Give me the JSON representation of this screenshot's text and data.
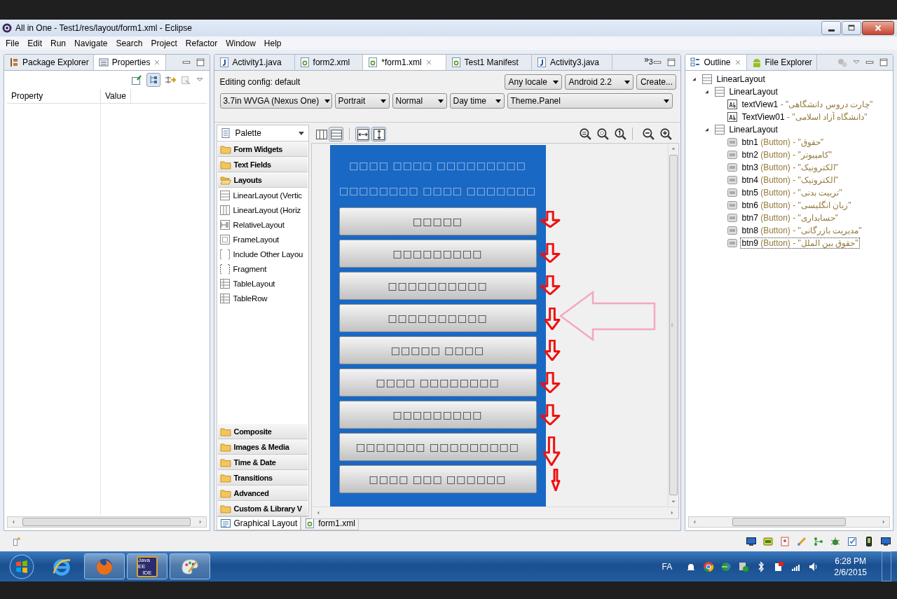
{
  "window": {
    "title": "All in One - Test1/res/layout/form1.xml - Eclipse"
  },
  "menu": [
    "File",
    "Edit",
    "Run",
    "Navigate",
    "Search",
    "Project",
    "Refactor",
    "Window",
    "Help"
  ],
  "left_panel": {
    "tabs": [
      {
        "label": "Package Explorer",
        "kind": "package",
        "selected": false
      },
      {
        "label": "Properties",
        "kind": "properties",
        "selected": true
      }
    ],
    "columns": [
      "Property",
      "Value"
    ]
  },
  "editor": {
    "tabs": [
      {
        "label": "Activity1.java",
        "kind": "java",
        "selected": false
      },
      {
        "label": "form2.xml",
        "kind": "xml",
        "selected": false
      },
      {
        "label": "*form1.xml",
        "kind": "xml",
        "selected": true
      },
      {
        "label": "Test1 Manifest",
        "kind": "xml",
        "selected": false
      },
      {
        "label": "Activity3.java",
        "kind": "java",
        "selected": false
      }
    ],
    "overflow": "»",
    "overflow_count": "3",
    "config": {
      "label": "Editing config:",
      "value": "default",
      "row1": [
        {
          "label": "Any locale",
          "kind": "dropdown"
        },
        {
          "label": "Android 2.2",
          "kind": "dropdown"
        },
        {
          "label": "Create...",
          "kind": "button"
        }
      ],
      "row2": [
        {
          "label": "3.7in WVGA (Nexus One)",
          "kind": "dropdown"
        },
        {
          "label": "Portrait",
          "kind": "dropdown"
        },
        {
          "label": "Normal",
          "kind": "dropdown"
        },
        {
          "label": "Day time",
          "kind": "dropdown"
        },
        {
          "label": "Theme.Panel",
          "kind": "dropdown"
        }
      ]
    },
    "palette": {
      "title": "Palette",
      "top": [
        {
          "label": "Form Widgets",
          "kind": "category",
          "expanded": false
        },
        {
          "label": "Text Fields",
          "kind": "category",
          "expanded": false
        },
        {
          "label": "Layouts",
          "kind": "category",
          "expanded": true
        },
        {
          "label": "LinearLayout (Vertic",
          "kind": "linear-vertical"
        },
        {
          "label": "LinearLayout (Horiz",
          "kind": "linear-horizontal"
        },
        {
          "label": "RelativeLayout",
          "kind": "relative"
        },
        {
          "label": "FrameLayout",
          "kind": "frame"
        },
        {
          "label": "Include Other Layou",
          "kind": "include"
        },
        {
          "label": "Fragment",
          "kind": "include"
        },
        {
          "label": "TableLayout",
          "kind": "table"
        },
        {
          "label": "TableRow",
          "kind": "table"
        }
      ],
      "bottom": [
        {
          "label": "Composite",
          "kind": "category",
          "expanded": false
        },
        {
          "label": "Images & Media",
          "kind": "category",
          "expanded": false
        },
        {
          "label": "Time & Date",
          "kind": "category",
          "expanded": false
        },
        {
          "label": "Transitions",
          "kind": "category",
          "expanded": false
        },
        {
          "label": "Advanced",
          "kind": "category",
          "expanded": false
        },
        {
          "label": "Custom & Library V",
          "kind": "category",
          "expanded": false
        }
      ]
    },
    "preview": {
      "header": [
        "□□□□ □□□□ □□□□□□□□□",
        "□□□□□□□□ □□□□ □□□□□□□"
      ],
      "buttons": [
        "□□□□□",
        "□□□□□□□□□",
        "□□□□□□□□□□",
        "□□□□□□□□□□",
        "□□□□□ □□□□",
        "□□□□ □□□□□□□□",
        "□□□□□□□□□",
        "□□□□□□□ □□□□□□□□□",
        "□□□□ □□□ □□□□□□"
      ]
    },
    "bottom_tabs": [
      {
        "label": "Graphical Layout",
        "kind": "graphical",
        "selected": true
      },
      {
        "label": "form1.xml",
        "kind": "xml",
        "selected": false
      }
    ]
  },
  "right_panel": {
    "tabs": [
      {
        "label": "Outline",
        "kind": "outline",
        "selected": true
      },
      {
        "label": "File Explorer",
        "kind": "android",
        "selected": false
      }
    ],
    "tree": [
      {
        "kind": "layout",
        "label": "LinearLayout",
        "expanded": true,
        "selected": false,
        "children": [
          {
            "kind": "layout",
            "label": "LinearLayout",
            "expanded": true,
            "selected": false,
            "children": [
              {
                "kind": "textview",
                "label": "textView1",
                "value": "- \"چارت دروس دانشگاهی\"",
                "selected": false
              },
              {
                "kind": "textview",
                "label": "TextView01",
                "value": "- \"دانشگاه آزاد اسلامی\"",
                "selected": false
              }
            ]
          },
          {
            "kind": "layout",
            "label": "LinearLayout",
            "expanded": true,
            "selected": false,
            "children": [
              {
                "kind": "button",
                "label": "btn1",
                "type": "(Button)",
                "value": "- \"حقوق\"",
                "selected": false
              },
              {
                "kind": "button",
                "label": "btn2",
                "type": "(Button)",
                "value": "- \"کامپیوتر\"",
                "selected": false
              },
              {
                "kind": "button",
                "label": "btn3",
                "type": "(Button)",
                "value": "- \"الکترونیک\"",
                "selected": false
              },
              {
                "kind": "button",
                "label": "btn4",
                "type": "(Button)",
                "value": "- \"الکترونیک\"",
                "selected": false
              },
              {
                "kind": "button",
                "label": "btn5",
                "type": "(Button)",
                "value": "- \"تربیت بدنی\"",
                "selected": false
              },
              {
                "kind": "button",
                "label": "btn6",
                "type": "(Button)",
                "value": "- \"زبان انگلیسی\"",
                "selected": false
              },
              {
                "kind": "button",
                "label": "btn7",
                "type": "(Button)",
                "value": "- \"حسابداری\"",
                "selected": false
              },
              {
                "kind": "button",
                "label": "btn8",
                "type": "(Button)",
                "value": "- \"مدیریت بازرگانی\"",
                "selected": false
              },
              {
                "kind": "button",
                "label": "btn9",
                "type": "(Button)",
                "value": "- \"حقوق بین الملل\"",
                "selected": true
              }
            ]
          }
        ]
      }
    ]
  },
  "taskbar": {
    "apps": [
      {
        "kind": "ie",
        "running": false
      },
      {
        "kind": "firefox",
        "running": true
      },
      {
        "kind": "javaee",
        "running": true,
        "label_lines": [
          "Java EE",
          "IDE"
        ]
      },
      {
        "kind": "paint",
        "running": true
      }
    ],
    "language": "FA",
    "time": "6:28 PM",
    "date": "2/6/2015"
  }
}
